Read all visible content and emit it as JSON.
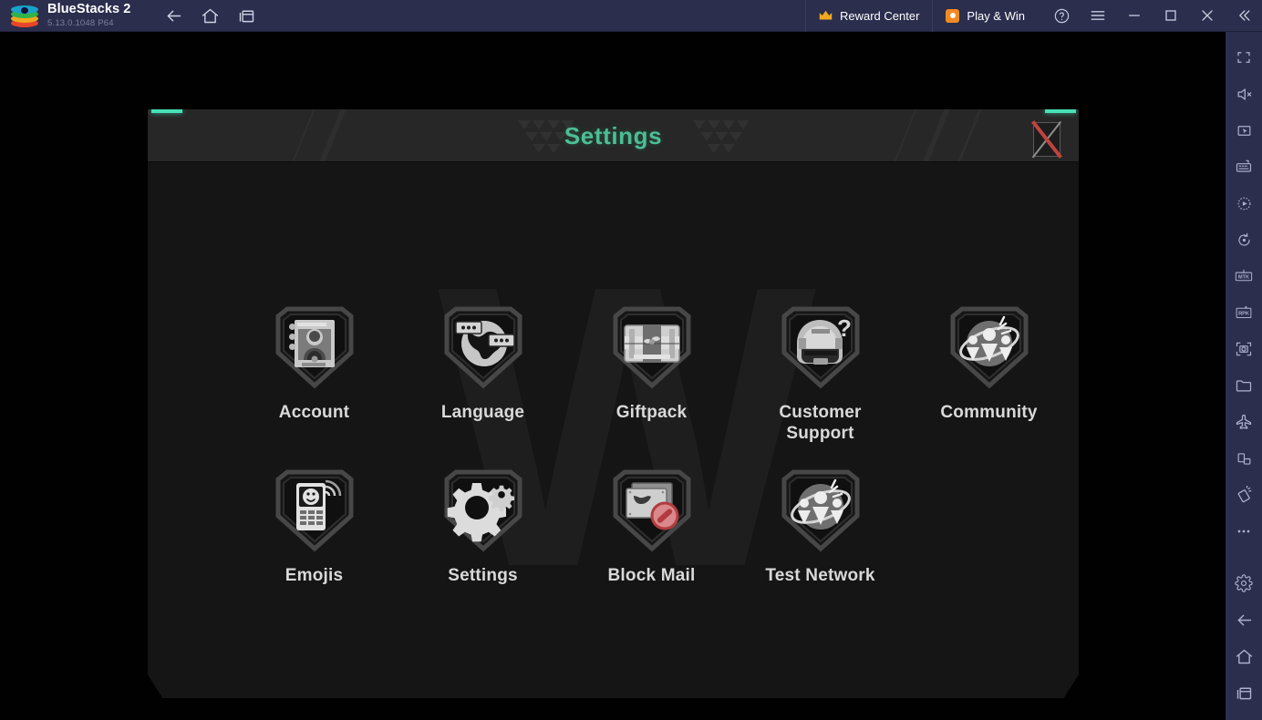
{
  "app": {
    "name": "BlueStacks 2",
    "version": "5.13.0.1048  P64",
    "logo_icon": "bluestacks-logo"
  },
  "topbar": {
    "nav": [
      {
        "name": "back-icon",
        "label": "Back"
      },
      {
        "name": "home-icon",
        "label": "Home"
      },
      {
        "name": "recents-icon",
        "label": "Recent apps"
      }
    ],
    "reward_center": {
      "label": "Reward Center",
      "icon": "crown-icon"
    },
    "play_and_win": {
      "label": "Play & Win",
      "icon": "coin-icon"
    },
    "window_buttons": [
      {
        "name": "help-icon",
        "label": "Help"
      },
      {
        "name": "menu-icon",
        "label": "Menu"
      },
      {
        "name": "minimize-icon",
        "label": "Minimize"
      },
      {
        "name": "maximize-icon",
        "label": "Maximize"
      },
      {
        "name": "close-icon",
        "label": "Close"
      },
      {
        "name": "collapse-icon",
        "label": "Collapse toolbar"
      }
    ]
  },
  "sidebar": {
    "items": [
      {
        "name": "fullscreen-icon",
        "label": "Full screen"
      },
      {
        "name": "mute-icon",
        "label": "Mute"
      },
      {
        "name": "cursor-icon",
        "label": "Game controls"
      },
      {
        "name": "keyboard-icon",
        "label": "Keyboard controls"
      },
      {
        "name": "macro-icon",
        "label": "Macro recorder"
      },
      {
        "name": "rotate-icon",
        "label": "Rotate"
      },
      {
        "name": "mtk-icon",
        "label": "MTK"
      },
      {
        "name": "rpk-icon",
        "label": "RPK"
      },
      {
        "name": "screenshot-icon",
        "label": "Screenshot"
      },
      {
        "name": "media-manager-icon",
        "label": "Media manager"
      },
      {
        "name": "airplane-icon",
        "label": "Airplane mode"
      },
      {
        "name": "multi-instance-icon",
        "label": "Multi-instance"
      },
      {
        "name": "shake-icon",
        "label": "Shake"
      },
      {
        "name": "more-icon",
        "label": "More"
      }
    ],
    "bottom_items": [
      {
        "name": "settings-gear-icon",
        "label": "Settings"
      },
      {
        "name": "android-back-icon",
        "label": "Back"
      },
      {
        "name": "android-home-icon",
        "label": "Home"
      },
      {
        "name": "android-recents-icon",
        "label": "Recent apps"
      }
    ]
  },
  "dialog": {
    "title": "Settings",
    "close_button": {
      "name": "close-dialog-button",
      "label": "Close"
    },
    "accent_color": "#47e0b4",
    "title_color": "#4dbd94",
    "watermark_text": "W",
    "rows": [
      [
        {
          "label": "Account",
          "icon": "account-badge-icon"
        },
        {
          "label": "Language",
          "icon": "language-badge-icon"
        },
        {
          "label": "Giftpack",
          "icon": "giftpack-badge-icon"
        },
        {
          "label": "Customer\nSupport",
          "icon": "customer-support-badge-icon"
        },
        {
          "label": "Community",
          "icon": "community-badge-icon"
        }
      ],
      [
        {
          "label": "Emojis",
          "icon": "emojis-badge-icon"
        },
        {
          "label": "Settings",
          "icon": "settings-gear-badge-icon"
        },
        {
          "label": "Block Mail",
          "icon": "block-mail-badge-icon"
        },
        {
          "label": "Test Network",
          "icon": "test-network-badge-icon"
        }
      ]
    ]
  }
}
